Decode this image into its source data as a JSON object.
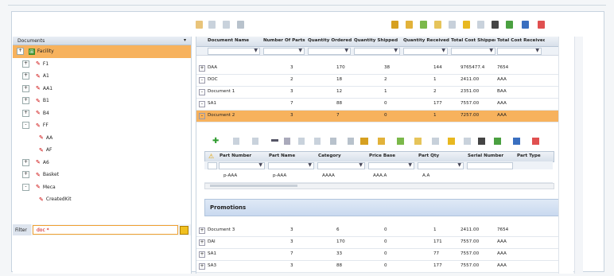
{
  "tree": {
    "header": "Documents",
    "items": [
      {
        "label": "Facility",
        "expander": "+",
        "selected": true
      },
      {
        "label": "F1",
        "expander": "+"
      },
      {
        "label": "A1",
        "expander": "+"
      },
      {
        "label": "AA1",
        "expander": "+"
      },
      {
        "label": "B1",
        "expander": "+"
      },
      {
        "label": "B4",
        "expander": "+"
      },
      {
        "label": "FF",
        "expander": "-"
      },
      {
        "label": "AA",
        "expander": ""
      },
      {
        "label": "AF",
        "expander": ""
      },
      {
        "label": "A6",
        "expander": "+"
      },
      {
        "label": "Basket",
        "expander": "+"
      },
      {
        "label": "Meca",
        "expander": "-"
      },
      {
        "label": "CreatedKit",
        "expander": ""
      }
    ],
    "filter_label": "Filter",
    "filter_value": "doc *"
  },
  "grid": {
    "columns": [
      "Document Name",
      "Number Of Parts",
      "Quantity Ordered",
      "Quantity Shipped",
      "Quantity Received",
      "Total Cost Shipped",
      "Total Cost Received"
    ],
    "rows": [
      {
        "pm": "+",
        "cells": [
          "DAA",
          "3",
          "170",
          "38",
          "144",
          "9765477.4",
          "7654"
        ]
      },
      {
        "pm": "-",
        "cells": [
          "DOC",
          "2",
          "18",
          "2",
          "1",
          "2411.00",
          "AAA"
        ]
      },
      {
        "pm": "-",
        "cells": [
          "Document 1",
          "3",
          "12",
          "1",
          "2",
          "2351.00",
          "BAA"
        ]
      },
      {
        "pm": "-",
        "cells": [
          "SA1",
          "7",
          "88",
          "0",
          "177",
          "7557.00",
          "AAA"
        ]
      },
      {
        "pm": "-",
        "cells": [
          "Document 2",
          "3",
          "7",
          "0",
          "1",
          "7257.00",
          "AAA"
        ],
        "selected": true
      }
    ],
    "rows_after": [
      {
        "pm": "+",
        "cells": [
          "Document 3",
          "3",
          "6",
          "0",
          "1",
          "2411.00",
          "7654"
        ]
      },
      {
        "pm": "+",
        "cells": [
          "DAI",
          "3",
          "170",
          "0",
          "171",
          "7557.00",
          "AAA"
        ]
      },
      {
        "pm": "+",
        "cells": [
          "SA1",
          "7",
          "33",
          "0",
          "77",
          "7557.00",
          "AAA"
        ]
      },
      {
        "pm": "+",
        "cells": [
          "SA3",
          "3",
          "88",
          "0",
          "177",
          "7557.00",
          "AAA"
        ]
      }
    ]
  },
  "detail": {
    "columns": [
      "Part Number",
      "Part Name",
      "Category",
      "Price Base",
      "Part Qty",
      "Serial Number",
      "Part Type"
    ],
    "row": [
      "p-AAA",
      "p-AAA",
      "AAAA",
      "AAA.A",
      "A.A"
    ],
    "group_label": "Promotions"
  },
  "colors": {
    "selection": "#f7b25d",
    "accent_green": "#3a8f2a",
    "header_blue": "#d8e0ea"
  }
}
